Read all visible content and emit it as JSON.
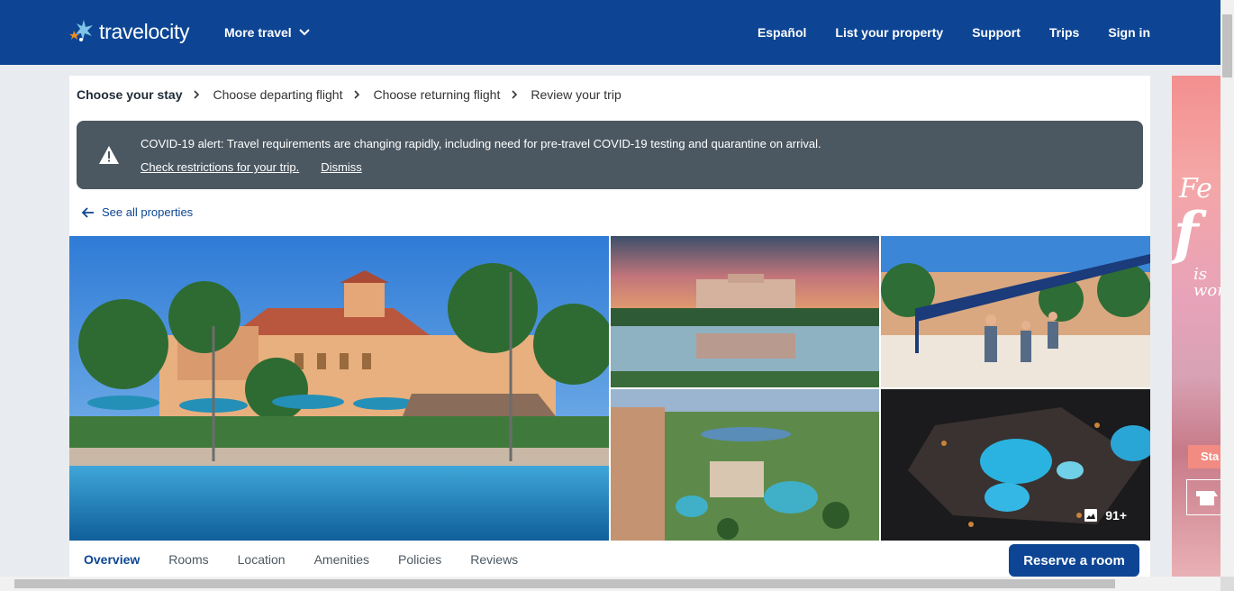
{
  "header": {
    "logo_text": "travelocity",
    "more_travel": "More travel",
    "nav": [
      "Español",
      "List your property",
      "Support",
      "Trips",
      "Sign in"
    ]
  },
  "steps": [
    "Choose your stay",
    "Choose departing flight",
    "Choose returning flight",
    "Review your trip"
  ],
  "alert": {
    "message": "COVID-19 alert: Travel requirements are changing rapidly, including need for pre-travel COVID-19 testing and quarantine on arrival.",
    "link_restrictions": "Check restrictions for your trip.",
    "link_dismiss": "Dismiss"
  },
  "see_all": "See all properties",
  "gallery": {
    "photo_count": "91+"
  },
  "tabs": [
    "Overview",
    "Rooms",
    "Location",
    "Amenities",
    "Policies",
    "Reviews"
  ],
  "reserve_label": "Reserve a room",
  "ad": {
    "line1": "Fe",
    "line2": "f",
    "line3": "is",
    "line4": "wor",
    "button": "Sta"
  },
  "colors": {
    "brand": "#0d4594",
    "alert_bg": "#4b5862"
  }
}
